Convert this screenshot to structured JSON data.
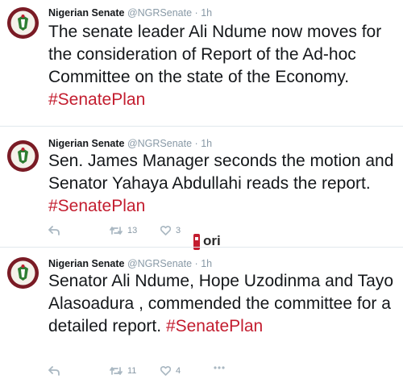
{
  "tweets": [
    {
      "name": "Nigerian Senate",
      "handle": "@NGRSenate",
      "dot": "·",
      "time": "1h",
      "text": "The senate leader Ali Ndume now moves for the consideration of Report of the Ad-hoc Committee on the state of the Economy.",
      "hashtag": "#SenatePlan"
    },
    {
      "name": "Nigerian Senate",
      "handle": "@NGRSenate",
      "dot": "·",
      "time": "1h",
      "text": "Sen. James Manager seconds the motion and Senator Yahaya Abdullahi reads the report.",
      "hashtag": "#SenatePlan",
      "retweets": "13",
      "likes": "3"
    },
    {
      "name": "Nigerian Senate",
      "handle": "@NGRSenate",
      "dot": "·",
      "time": "1h",
      "text": "Senator Ali Ndume, Hope Uzodinma and Tayo Alasoadura , commended the committee for a detailed report.",
      "hashtag": "#SenatePlan",
      "retweets": "11",
      "likes": "4"
    }
  ],
  "watermark": {
    "text": "ori"
  },
  "colors": {
    "hashtag": "#c31d2f",
    "muted": "#8899a6",
    "divider": "#e1e8ed",
    "icon": "#aab8c2"
  }
}
